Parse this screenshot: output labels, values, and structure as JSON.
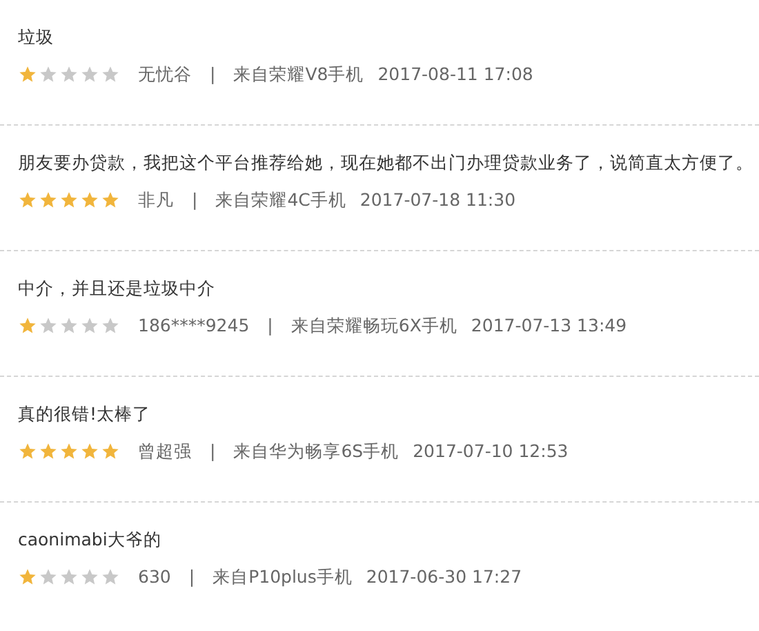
{
  "reviews": [
    {
      "text": "垃圾",
      "stars": 1,
      "user": "无忧谷",
      "separator": "|",
      "device": "来自荣耀V8手机",
      "time": "2017-08-11 17:08"
    },
    {
      "text": "朋友要办贷款，我把这个平台推荐给她，现在她都不出门办理贷款业务了，说简直太方便了。",
      "stars": 5,
      "user": "非凡",
      "separator": "|",
      "device": "来自荣耀4C手机",
      "time": "2017-07-18 11:30"
    },
    {
      "text": "中介，并且还是垃圾中介",
      "stars": 1,
      "user": "186****9245",
      "separator": "|",
      "device": "来自荣耀畅玩6X手机",
      "time": "2017-07-13 13:49"
    },
    {
      "text": "真的很错!太棒了",
      "stars": 5,
      "user": "曾超强",
      "separator": "|",
      "device": "来自华为畅享6S手机",
      "time": "2017-07-10 12:53"
    },
    {
      "text": "caonimabi大爷的",
      "stars": 1,
      "user": "630",
      "separator": "|",
      "device": "来自P10plus手机",
      "time": "2017-06-30 17:27"
    }
  ]
}
